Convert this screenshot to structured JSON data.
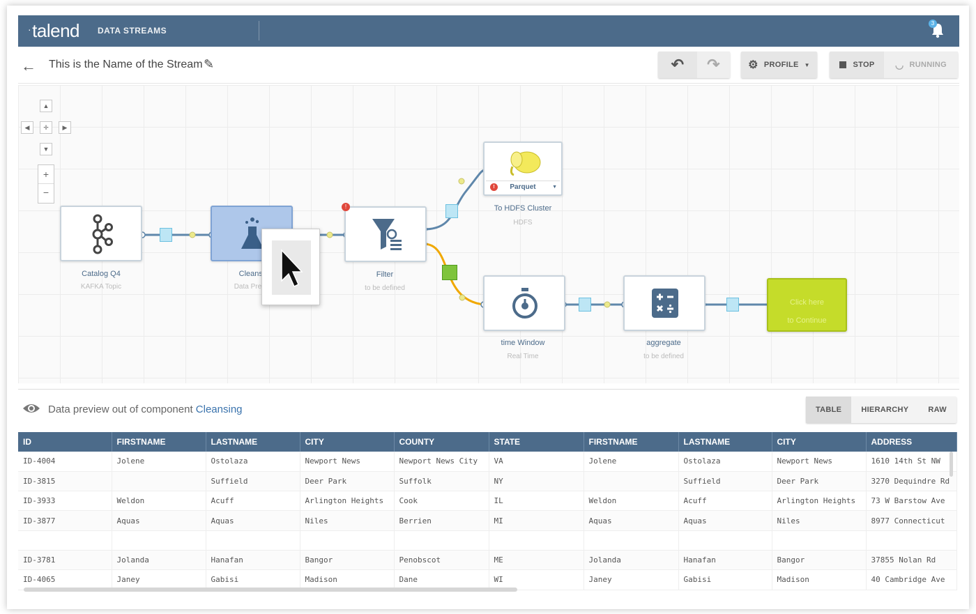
{
  "app": {
    "logo": "talend",
    "product": "DATA STREAMS",
    "notification_count": "3"
  },
  "header": {
    "stream_name": "This is the Name of the Stream"
  },
  "toolbar": {
    "profile_label": "PROFILE",
    "stop_label": "STOP",
    "running_label": "RUNNING"
  },
  "pipeline": {
    "nodes": {
      "source": {
        "title": "Catalog Q4",
        "subtitle": "KAFKA Topic"
      },
      "cleansing": {
        "title": "Cleansi",
        "subtitle": "Data Prepa"
      },
      "filter": {
        "title": "Filter",
        "subtitle": "to be defined"
      },
      "hdfs": {
        "title": "To HDFS Cluster",
        "subtitle": "HDFS",
        "format": "Parquet"
      },
      "window": {
        "title": "time Window",
        "subtitle": "Real Time"
      },
      "aggregate": {
        "title": "aggregate",
        "subtitle": "to be defined"
      },
      "continue": {
        "line1": "Click here",
        "line2": "to Continue"
      }
    }
  },
  "preview": {
    "label": "Data preview out of component",
    "component": "Cleansing",
    "tabs": [
      "TABLE",
      "HIERARCHY",
      "RAW"
    ],
    "columns": [
      "ID",
      "FIRSTNAME",
      "LASTNAME",
      "CITY",
      "COUNTY",
      "STATE",
      "FIRSTNAME",
      "LASTNAME",
      "CITY",
      "ADDRESS"
    ],
    "rows": [
      [
        "ID-4004",
        "Jolene",
        "Ostolaza",
        "Newport News",
        "Newport News City",
        "VA",
        "Jolene",
        "Ostolaza",
        "Newport News",
        "1610 14th St NW"
      ],
      [
        "ID-3815",
        "",
        "Suffield",
        "Deer Park",
        "Suffolk",
        "NY",
        "",
        "Suffield",
        "Deer Park",
        "3270 Dequindre Rd"
      ],
      [
        "ID-3933",
        "Weldon",
        "Acuff",
        "Arlington Heights",
        "Cook",
        "IL",
        "Weldon",
        "Acuff",
        "Arlington Heights",
        "73 W Barstow Ave"
      ],
      [
        "ID-3877",
        "Aquas",
        "Aquas",
        "Niles",
        "Berrien",
        "MI",
        "Aquas",
        "Aquas",
        "Niles",
        "8977 Connecticut"
      ],
      [
        "",
        "",
        "",
        "",
        "",
        "",
        "",
        "",
        "",
        ""
      ],
      [
        "ID-3781",
        "Jolanda",
        "Hanafan",
        "Bangor",
        "Penobscot",
        "ME",
        "Jolanda",
        "Hanafan",
        "Bangor",
        "37855 Nolan Rd"
      ],
      [
        "ID-4065",
        "Janey",
        "Gabisi",
        "Madison",
        "Dane",
        "WI",
        "Janey",
        "Gabisi",
        "Madison",
        "40 Cambridge Ave"
      ]
    ]
  }
}
